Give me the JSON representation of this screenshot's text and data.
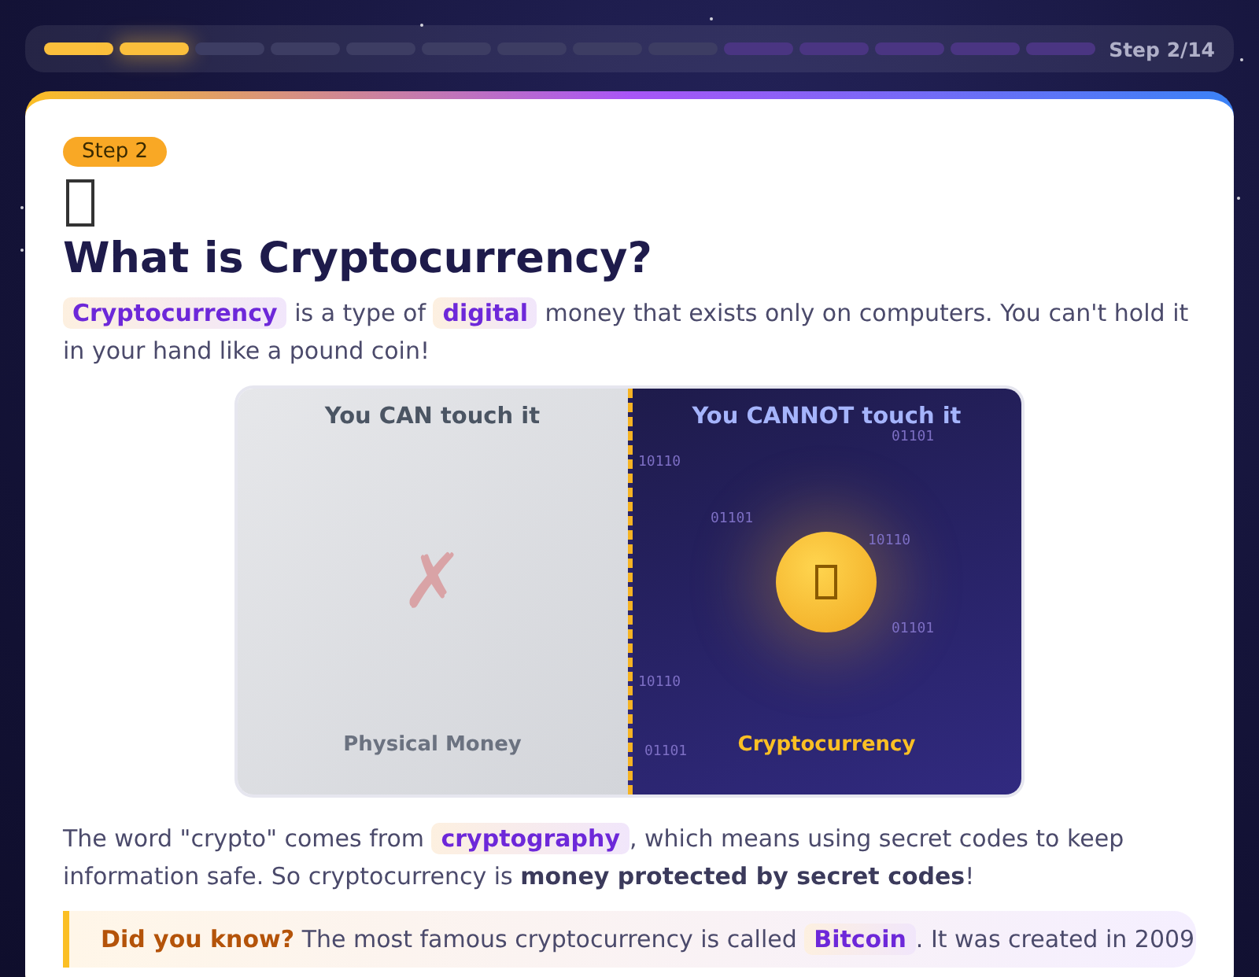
{
  "progress": {
    "segments": [
      {
        "kind": "done"
      },
      {
        "kind": "current"
      },
      {
        "kind": "plain"
      },
      {
        "kind": "plain"
      },
      {
        "kind": "plain"
      },
      {
        "kind": "plain"
      },
      {
        "kind": "plain"
      },
      {
        "kind": "plain"
      },
      {
        "kind": "plain"
      },
      {
        "kind": "locked"
      },
      {
        "kind": "locked"
      },
      {
        "kind": "locked"
      },
      {
        "kind": "locked"
      },
      {
        "kind": "locked"
      }
    ],
    "label": "Step 2/14"
  },
  "card": {
    "badge": "Step 2",
    "title": "What is Cryptocurrency?",
    "intro": [
      {
        "kind": "term",
        "text": "Cryptocurrency"
      },
      {
        "kind": "plain",
        "text": " is a type of "
      },
      {
        "kind": "term",
        "text": "digital"
      },
      {
        "kind": "plain",
        "text": " money that exists only on computers. You can't hold it in your hand like a pound coin!"
      }
    ],
    "comparison": {
      "left": {
        "heading": "You CAN touch it",
        "mark": "✗",
        "caption": "Physical Money"
      },
      "right": {
        "heading": "You CANNOT touch it",
        "caption": "Cryptocurrency",
        "binary": [
          "01101",
          "10110",
          "01101",
          "10110",
          "01101",
          "10110",
          "01101"
        ]
      }
    },
    "explanation": [
      {
        "kind": "plain",
        "text": "The word \"crypto\" comes from "
      },
      {
        "kind": "term",
        "text": "cryptography"
      },
      {
        "kind": "plain",
        "text": ", which means using secret codes to keep information safe. So cryptocurrency is "
      },
      {
        "kind": "bold",
        "text": "money protected by secret codes"
      },
      {
        "kind": "plain",
        "text": "!"
      }
    ],
    "fact": [
      {
        "kind": "lead",
        "text": "Did you know?"
      },
      {
        "kind": "plain",
        "text": " The most famous cryptocurrency is called "
      },
      {
        "kind": "term",
        "text": "Bitcoin"
      },
      {
        "kind": "plain",
        "text": ". It was created in 2009"
      }
    ]
  }
}
